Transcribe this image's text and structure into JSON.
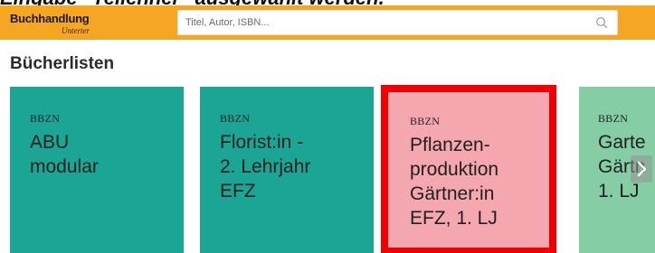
{
  "caption": {
    "text": "Eingabe \"Teilehner\" ausgewählt werden."
  },
  "header": {
    "logo_main": "Buchhandlung",
    "logo_sub": "Unterter",
    "search_placeholder": "Titel, Autor, ISBN...",
    "icons": {
      "search": "search-icon"
    },
    "colors": {
      "bar": "#f5a623"
    }
  },
  "section": {
    "title": "Bücherlisten"
  },
  "cards": [
    {
      "publisher": "BBZN",
      "title_lines": [
        "ABU",
        "modular"
      ],
      "color": "#1aa595"
    },
    {
      "publisher": "BBZN",
      "title_lines": [
        "Florist:in -",
        "2. Lehrjahr",
        "EFZ"
      ],
      "color": "#1aa595"
    },
    {
      "publisher": "BBZN",
      "title_lines": [
        "Pflanzen-",
        "produktion",
        "Gärtner:in",
        "EFZ, 1. LJ"
      ],
      "color": "#f4a7ae",
      "highlight": "#f00000"
    },
    {
      "publisher": "BBZN",
      "title_lines": [
        "Garte",
        "Gärtn",
        "1. LJ"
      ],
      "color": "#85cda5"
    }
  ],
  "carousel": {
    "next_icon": "chevron-right-icon"
  }
}
